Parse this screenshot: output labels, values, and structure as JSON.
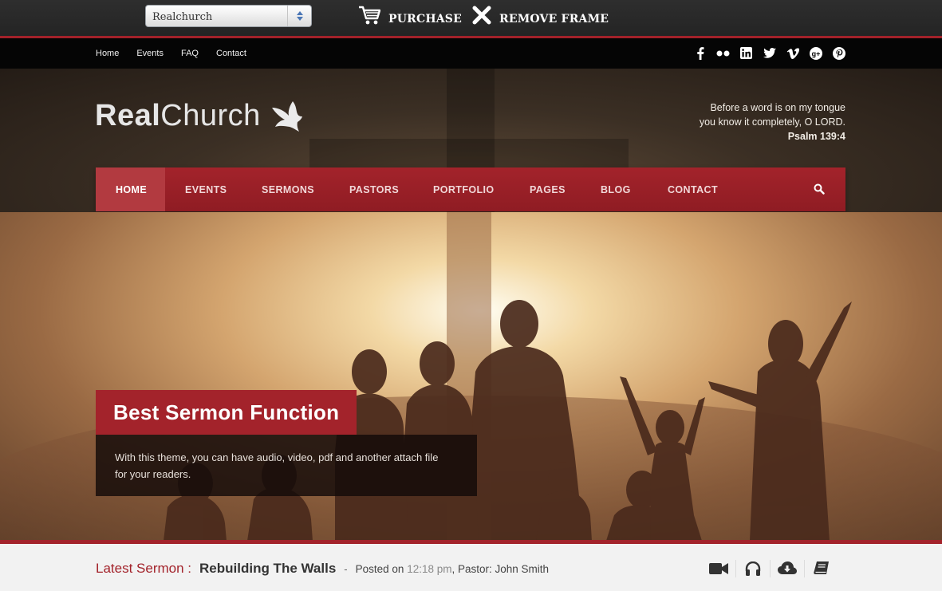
{
  "frame": {
    "theme_select_value": "Realchurch",
    "purchase_label": "PURCHASE",
    "remove_frame_label": "REMOVE FRAME"
  },
  "top_nav": {
    "links": [
      "Home",
      "Events",
      "FAQ",
      "Contact"
    ],
    "social_icons": [
      "facebook-icon",
      "flickr-icon",
      "linkedin-icon",
      "twitter-icon",
      "vimeo-icon",
      "google-plus-icon",
      "pinterest-icon"
    ]
  },
  "header": {
    "logo_real": "Real",
    "logo_church": "Church",
    "verse_line1": "Before a word is on my tongue",
    "verse_line2": "you know it completely, O LORD.",
    "verse_ref": "Psalm 139:4"
  },
  "main_nav": {
    "items": [
      "HOME",
      "EVENTS",
      "SERMONS",
      "PASTORS",
      "PORTFOLIO",
      "PAGES",
      "BLOG",
      "CONTACT"
    ],
    "active": "HOME"
  },
  "hero": {
    "caption_title": "Best Sermon Function",
    "caption_line1": "With this theme, you can have audio, video, pdf and another attach file",
    "caption_line2": "for your readers."
  },
  "latest_sermon": {
    "label": "Latest Sermon :",
    "title": "Rebuilding The Walls",
    "separator": "-",
    "posted_on": "Posted on",
    "time": "12:18 pm",
    "pastor": ", Pastor: John Smith",
    "actions": [
      "video-icon",
      "audio-icon",
      "download-icon",
      "book-icon"
    ]
  },
  "colors": {
    "accent": "#a3232b",
    "frame_bg": "#2a2a2a",
    "topnav_bg": "#050505"
  }
}
